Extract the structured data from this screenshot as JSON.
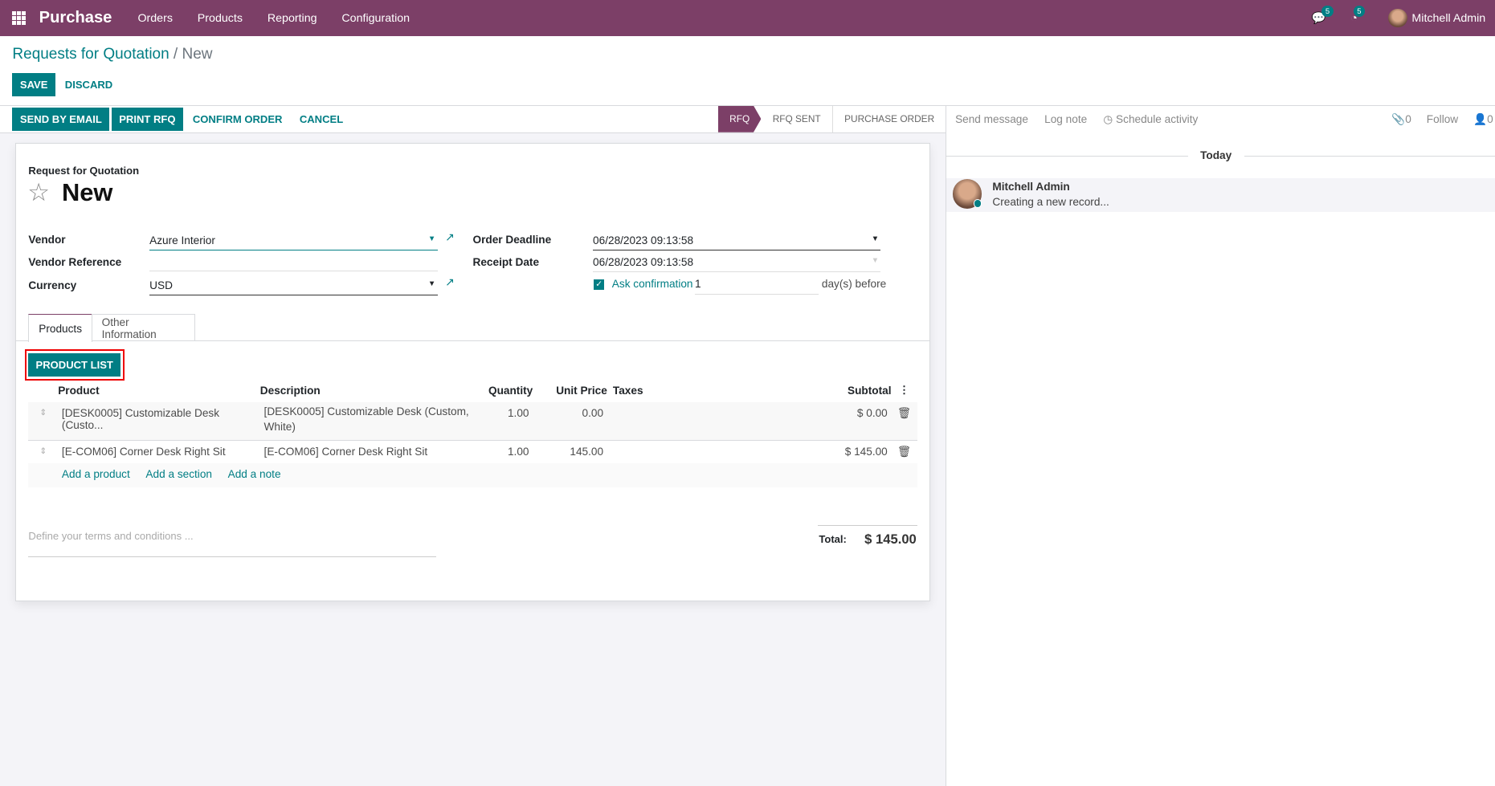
{
  "navbar": {
    "app": "Purchase",
    "menus": [
      "Orders",
      "Products",
      "Reporting",
      "Configuration"
    ],
    "messages_count": "5",
    "activities_count": "5",
    "user": "Mitchell Admin"
  },
  "breadcrumb": {
    "parent": "Requests for Quotation",
    "current": "New"
  },
  "actions": {
    "save": "Save",
    "discard": "Discard"
  },
  "statusbar": {
    "buttons": [
      "Send by Email",
      "Print RFQ",
      "Confirm Order",
      "Cancel"
    ],
    "stages": [
      "RFQ",
      "RFQ Sent",
      "Purchase Order"
    ],
    "active_stage": "RFQ"
  },
  "form": {
    "subtitle": "Request for Quotation",
    "title": "New",
    "vendor_label": "Vendor",
    "vendor": "Azure Interior",
    "vendor_ref_label": "Vendor Reference",
    "vendor_ref": "",
    "currency_label": "Currency",
    "currency": "USD",
    "order_deadline_label": "Order Deadline",
    "order_deadline": "06/28/2023 09:13:58",
    "receipt_date_label": "Receipt Date",
    "receipt_date": "06/28/2023 09:13:58",
    "ask_confirmation_label": "Ask confirmation",
    "ask_confirmation_checked": true,
    "ask_days": "1",
    "days_suffix": "day(s) before"
  },
  "tabs": [
    "Products",
    "Other Information"
  ],
  "product_list_button": "Product List",
  "lines": {
    "headers": [
      "Product",
      "Description",
      "Quantity",
      "Unit Price",
      "Taxes",
      "Subtotal"
    ],
    "rows": [
      {
        "product": "[DESK0005] Customizable Desk (Custo...",
        "description": "[DESK0005] Customizable Desk (Custom, White)",
        "quantity": "1.00",
        "unit_price": "0.00",
        "taxes": "",
        "subtotal": "$ 0.00"
      },
      {
        "product": "[E-COM06] Corner Desk Right Sit",
        "description": "[E-COM06] Corner Desk Right Sit",
        "quantity": "1.00",
        "unit_price": "145.00",
        "taxes": "",
        "subtotal": "$ 145.00"
      }
    ],
    "add_links": [
      "Add a product",
      "Add a section",
      "Add a note"
    ]
  },
  "terms_placeholder": "Define your terms and conditions ...",
  "total": {
    "label": "Total:",
    "value": "$ 145.00"
  },
  "chatter": {
    "send_message": "Send message",
    "log_note": "Log note",
    "schedule_activity": "Schedule activity",
    "attachments": "0",
    "follow": "Follow",
    "followers": "0",
    "date_sep": "Today",
    "author": "Mitchell Admin",
    "message": "Creating a new record..."
  },
  "colors": {
    "brand": "#7c3f67",
    "accent": "#017e84"
  }
}
